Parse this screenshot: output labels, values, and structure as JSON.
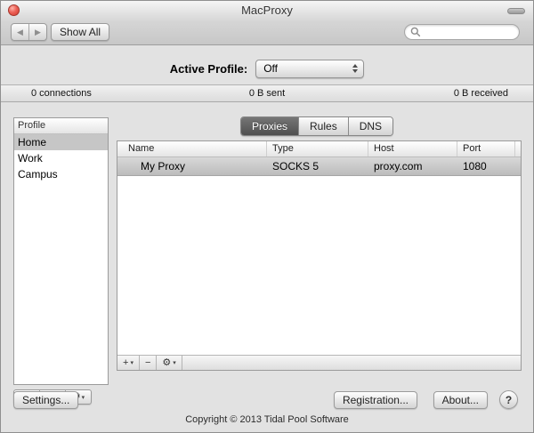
{
  "window": {
    "title": "MacProxy"
  },
  "toolbar": {
    "back_glyph": "◀",
    "forward_glyph": "▶",
    "show_all_label": "Show All",
    "search_value": ""
  },
  "active_profile": {
    "label": "Active Profile:",
    "value": "Off"
  },
  "status_bar": {
    "connections": "0 connections",
    "sent": "0 B sent",
    "received": "0 B received"
  },
  "sidebar": {
    "header": "Profile",
    "items": [
      {
        "label": "Home",
        "selected": true
      },
      {
        "label": "Work",
        "selected": false
      },
      {
        "label": "Campus",
        "selected": false
      }
    ]
  },
  "tabs": [
    {
      "label": "Proxies",
      "selected": true
    },
    {
      "label": "Rules",
      "selected": false
    },
    {
      "label": "DNS",
      "selected": false
    }
  ],
  "table": {
    "columns": [
      "Name",
      "Type",
      "Host",
      "Port"
    ],
    "rows": [
      {
        "name": "My Proxy",
        "type": "SOCKS 5",
        "host": "proxy.com",
        "port": "1080",
        "selected": true
      }
    ]
  },
  "actions": {
    "plus": "+",
    "minus": "−",
    "gear": "⚙",
    "dropdown": "▾"
  },
  "buttons": {
    "settings": "Settings...",
    "registration": "Registration...",
    "about": "About...",
    "help": "?"
  },
  "footer": {
    "copyright": "Copyright © 2013 Tidal Pool Software"
  },
  "colors": {
    "close_button_red": "#d23b2f",
    "selected_tab_gray": "#5f5f5f",
    "selection_gray": "#c6c6c6"
  }
}
